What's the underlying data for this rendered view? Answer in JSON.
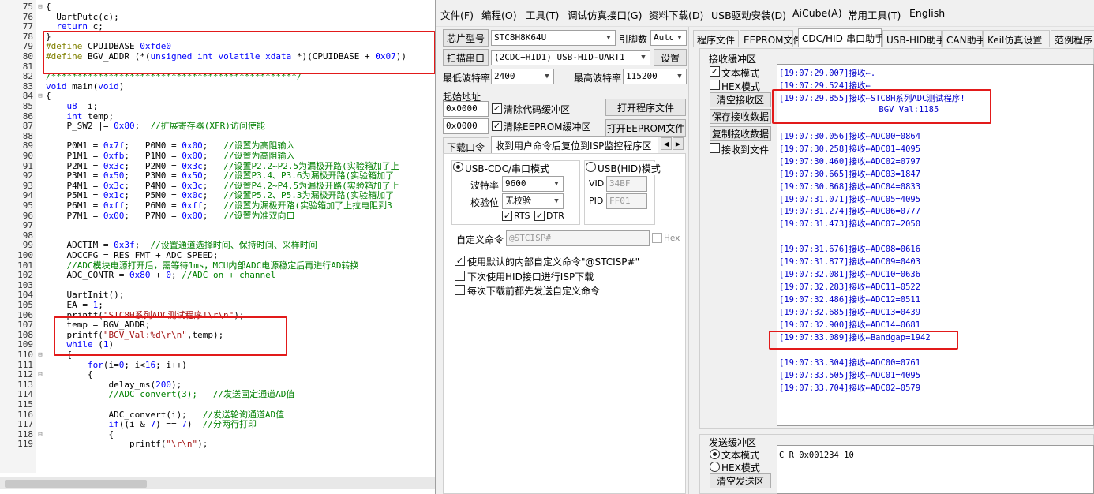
{
  "editor": {
    "lines": [
      {
        "n": "75",
        "f": "⊟",
        "t": [
          {
            "c": "pl",
            "v": "{"
          }
        ]
      },
      {
        "n": "76",
        "f": "",
        "t": [
          {
            "c": "pl",
            "v": "  UartPutc(c);"
          }
        ]
      },
      {
        "n": "77",
        "f": "",
        "t": [
          {
            "c": "kw",
            "v": "  return"
          },
          {
            "c": "pl",
            "v": " c;"
          }
        ]
      },
      {
        "n": "78",
        "f": "",
        "t": [
          {
            "c": "pl",
            "v": "}"
          }
        ]
      },
      {
        "n": "79",
        "f": "",
        "t": [
          {
            "c": "pp",
            "v": "#define"
          },
          {
            "c": "pl",
            "v": " CPUIDBASE "
          },
          {
            "c": "num",
            "v": "0xfde0"
          }
        ]
      },
      {
        "n": "80",
        "f": "",
        "t": [
          {
            "c": "pp",
            "v": "#define"
          },
          {
            "c": "pl",
            "v": " BGV_ADDR (*("
          },
          {
            "c": "kw",
            "v": "unsigned int volatile xdata"
          },
          {
            "c": "pl",
            "v": " *)(CPUIDBASE + "
          },
          {
            "c": "num",
            "v": "0x07"
          },
          {
            "c": "pl",
            "v": "))"
          }
        ]
      },
      {
        "n": "81",
        "f": "",
        "t": []
      },
      {
        "n": "82",
        "f": "",
        "t": [
          {
            "c": "cm",
            "v": "/***********************************************/"
          }
        ]
      },
      {
        "n": "83",
        "f": "",
        "t": [
          {
            "c": "kw",
            "v": "void"
          },
          {
            "c": "pl",
            "v": " main("
          },
          {
            "c": "kw",
            "v": "void"
          },
          {
            "c": "pl",
            "v": ")"
          }
        ]
      },
      {
        "n": "84",
        "f": "⊟",
        "t": [
          {
            "c": "pl",
            "v": "{"
          }
        ]
      },
      {
        "n": "85",
        "f": "",
        "t": [
          {
            "c": "kw",
            "v": "    u8"
          },
          {
            "c": "pl",
            "v": "  i;"
          }
        ]
      },
      {
        "n": "86",
        "f": "",
        "t": [
          {
            "c": "kw",
            "v": "    int"
          },
          {
            "c": "pl",
            "v": " temp;"
          }
        ]
      },
      {
        "n": "87",
        "f": "",
        "t": [
          {
            "c": "pl",
            "v": "    P_SW2 |= "
          },
          {
            "c": "num",
            "v": "0x80"
          },
          {
            "c": "pl",
            "v": ";  "
          },
          {
            "c": "cm",
            "v": "//扩展寄存器(XFR)访问使能"
          }
        ]
      },
      {
        "n": "88",
        "f": "",
        "t": []
      },
      {
        "n": "89",
        "f": "",
        "t": [
          {
            "c": "pl",
            "v": "    P0M1 = "
          },
          {
            "c": "num",
            "v": "0x7f"
          },
          {
            "c": "pl",
            "v": ";   P0M0 = "
          },
          {
            "c": "num",
            "v": "0x00"
          },
          {
            "c": "pl",
            "v": ";   "
          },
          {
            "c": "cm",
            "v": "//设置为高阻输入"
          }
        ]
      },
      {
        "n": "90",
        "f": "",
        "t": [
          {
            "c": "pl",
            "v": "    P1M1 = "
          },
          {
            "c": "num",
            "v": "0xfb"
          },
          {
            "c": "pl",
            "v": ";   P1M0 = "
          },
          {
            "c": "num",
            "v": "0x00"
          },
          {
            "c": "pl",
            "v": ";   "
          },
          {
            "c": "cm",
            "v": "//设置为高阻输入"
          }
        ]
      },
      {
        "n": "91",
        "f": "",
        "t": [
          {
            "c": "pl",
            "v": "    P2M1 = "
          },
          {
            "c": "num",
            "v": "0x3c"
          },
          {
            "c": "pl",
            "v": ";   P2M0 = "
          },
          {
            "c": "num",
            "v": "0x3c"
          },
          {
            "c": "pl",
            "v": ";   "
          },
          {
            "c": "cm",
            "v": "//设置P2.2~P2.5为漏极开路(实验箱加了上"
          }
        ]
      },
      {
        "n": "92",
        "f": "",
        "t": [
          {
            "c": "pl",
            "v": "    P3M1 = "
          },
          {
            "c": "num",
            "v": "0x50"
          },
          {
            "c": "pl",
            "v": ";   P3M0 = "
          },
          {
            "c": "num",
            "v": "0x50"
          },
          {
            "c": "pl",
            "v": ";   "
          },
          {
            "c": "cm",
            "v": "//设置P3.4、P3.6为漏极开路(实验箱加了"
          }
        ]
      },
      {
        "n": "93",
        "f": "",
        "t": [
          {
            "c": "pl",
            "v": "    P4M1 = "
          },
          {
            "c": "num",
            "v": "0x3c"
          },
          {
            "c": "pl",
            "v": ";   P4M0 = "
          },
          {
            "c": "num",
            "v": "0x3c"
          },
          {
            "c": "pl",
            "v": ";   "
          },
          {
            "c": "cm",
            "v": "//设置P4.2~P4.5为漏极开路(实验箱加了上"
          }
        ]
      },
      {
        "n": "94",
        "f": "",
        "t": [
          {
            "c": "pl",
            "v": "    P5M1 = "
          },
          {
            "c": "num",
            "v": "0x1c"
          },
          {
            "c": "pl",
            "v": ";   P5M0 = "
          },
          {
            "c": "num",
            "v": "0x0c"
          },
          {
            "c": "pl",
            "v": ";   "
          },
          {
            "c": "cm",
            "v": "//设置P5.2、P5.3为漏极开路(实验箱加了"
          }
        ]
      },
      {
        "n": "95",
        "f": "",
        "t": [
          {
            "c": "pl",
            "v": "    P6M1 = "
          },
          {
            "c": "num",
            "v": "0xff"
          },
          {
            "c": "pl",
            "v": ";   P6M0 = "
          },
          {
            "c": "num",
            "v": "0xff"
          },
          {
            "c": "pl",
            "v": ";   "
          },
          {
            "c": "cm",
            "v": "//设置为漏极开路(实验箱加了上拉电阻到3"
          }
        ]
      },
      {
        "n": "96",
        "f": "",
        "t": [
          {
            "c": "pl",
            "v": "    P7M1 = "
          },
          {
            "c": "num",
            "v": "0x00"
          },
          {
            "c": "pl",
            "v": ";   P7M0 = "
          },
          {
            "c": "num",
            "v": "0x00"
          },
          {
            "c": "pl",
            "v": ";   "
          },
          {
            "c": "cm",
            "v": "//设置为准双向口"
          }
        ]
      },
      {
        "n": "97",
        "f": "",
        "t": []
      },
      {
        "n": "98",
        "f": "",
        "t": []
      },
      {
        "n": "99",
        "f": "",
        "t": [
          {
            "c": "pl",
            "v": "    ADCTIM = "
          },
          {
            "c": "num",
            "v": "0x3f"
          },
          {
            "c": "pl",
            "v": ";  "
          },
          {
            "c": "cm",
            "v": "//设置通道选择时间、保持时间、采样时间"
          }
        ]
      },
      {
        "n": "100",
        "f": "",
        "t": [
          {
            "c": "pl",
            "v": "    ADCCFG = RES_FMT + ADC_SPEED;"
          }
        ]
      },
      {
        "n": "101",
        "f": "",
        "t": [
          {
            "c": "cm",
            "v": "    //ADC模块电源打开后，需等待1ms，MCU内部ADC电源稳定后再进行AD转换"
          }
        ]
      },
      {
        "n": "102",
        "f": "",
        "t": [
          {
            "c": "pl",
            "v": "    ADC_CONTR = "
          },
          {
            "c": "num",
            "v": "0x80"
          },
          {
            "c": "pl",
            "v": " + "
          },
          {
            "c": "num",
            "v": "0"
          },
          {
            "c": "pl",
            "v": "; "
          },
          {
            "c": "cm",
            "v": "//ADC on + channel"
          }
        ]
      },
      {
        "n": "103",
        "f": "",
        "t": []
      },
      {
        "n": "104",
        "f": "",
        "t": [
          {
            "c": "pl",
            "v": "    UartInit();"
          }
        ]
      },
      {
        "n": "105",
        "f": "",
        "t": [
          {
            "c": "pl",
            "v": "    EA = "
          },
          {
            "c": "num",
            "v": "1"
          },
          {
            "c": "pl",
            "v": ";"
          }
        ]
      },
      {
        "n": "106",
        "f": "",
        "t": [
          {
            "c": "pl",
            "v": "    printf("
          },
          {
            "c": "str",
            "v": "\"STC8H系列ADC测试程序!\\r\\n\""
          },
          {
            "c": "pl",
            "v": ");"
          }
        ]
      },
      {
        "n": "107",
        "f": "",
        "t": [
          {
            "c": "pl",
            "v": "    temp = BGV_ADDR;"
          }
        ]
      },
      {
        "n": "108",
        "f": "",
        "t": [
          {
            "c": "pl",
            "v": "    printf("
          },
          {
            "c": "str",
            "v": "\"BGV_Val:%d\\r\\n\""
          },
          {
            "c": "pl",
            "v": ",temp);"
          }
        ]
      },
      {
        "n": "109",
        "f": "",
        "t": [
          {
            "c": "kw",
            "v": "    while"
          },
          {
            "c": "pl",
            "v": " ("
          },
          {
            "c": "num",
            "v": "1"
          },
          {
            "c": "pl",
            "v": ")"
          }
        ]
      },
      {
        "n": "110",
        "f": "⊟",
        "t": [
          {
            "c": "pl",
            "v": "    {"
          }
        ]
      },
      {
        "n": "111",
        "f": "",
        "t": [
          {
            "c": "kw",
            "v": "        for"
          },
          {
            "c": "pl",
            "v": "(i="
          },
          {
            "c": "num",
            "v": "0"
          },
          {
            "c": "pl",
            "v": "; i<"
          },
          {
            "c": "num",
            "v": "16"
          },
          {
            "c": "pl",
            "v": "; i++)"
          }
        ]
      },
      {
        "n": "112",
        "f": "⊟",
        "t": [
          {
            "c": "pl",
            "v": "        {"
          }
        ]
      },
      {
        "n": "113",
        "f": "",
        "t": [
          {
            "c": "pl",
            "v": "            delay_ms("
          },
          {
            "c": "num",
            "v": "200"
          },
          {
            "c": "pl",
            "v": ");"
          }
        ]
      },
      {
        "n": "114",
        "f": "",
        "t": [
          {
            "c": "cm",
            "v": "            //ADC_convert(3);   //发送固定通道AD值"
          }
        ]
      },
      {
        "n": "115",
        "f": "",
        "t": []
      },
      {
        "n": "116",
        "f": "",
        "t": [
          {
            "c": "pl",
            "v": "            ADC_convert(i);   "
          },
          {
            "c": "cm",
            "v": "//发送轮询通道AD值"
          }
        ]
      },
      {
        "n": "117",
        "f": "",
        "t": [
          {
            "c": "kw",
            "v": "            if"
          },
          {
            "c": "pl",
            "v": "((i & "
          },
          {
            "c": "num",
            "v": "7"
          },
          {
            "c": "pl",
            "v": ") == "
          },
          {
            "c": "num",
            "v": "7"
          },
          {
            "c": "pl",
            "v": ")  "
          },
          {
            "c": "cm",
            "v": "//分两行打印"
          }
        ]
      },
      {
        "n": "118",
        "f": "⊟",
        "t": [
          {
            "c": "pl",
            "v": "            {"
          }
        ]
      },
      {
        "n": "119",
        "f": "",
        "t": [
          {
            "c": "pl",
            "v": "                printf("
          },
          {
            "c": "str",
            "v": "\"\\r\\n\""
          },
          {
            "c": "pl",
            "v": ");"
          }
        ]
      }
    ]
  },
  "menubar": [
    "文件(F)",
    "编程(O)",
    "工具(T)",
    "调试仿真接口(G)",
    "资料下载(D)",
    "USB驱动安装(D)",
    "AiCube(A)",
    "常用工具(T)",
    "English"
  ],
  "left": {
    "chip_btn": "芯片型号",
    "chip_val": "STC8H8K64U",
    "pin_label": "引脚数",
    "pin_val": "Auto",
    "scan_btn": "扫描串口",
    "port_val": "(2CDC+HID1) USB-HID-UART1",
    "settings_btn": "设置",
    "min_baud_label": "最低波特率",
    "min_baud": "2400",
    "max_baud_label": "最高波特率",
    "max_baud": "115200",
    "start_addr_label": "起始地址",
    "addr1": "0x0000",
    "clear_code_label": "清除代码缓冲区",
    "open_prog_btn": "打开程序文件",
    "addr2": "0x0000",
    "clear_eeprom_label": "清除EEPROM缓冲区",
    "open_eeprom_btn": "打开EEPROM文件",
    "tab_download": "下载口令",
    "tab_isp": "收到用户命令后复位到ISP监控程序区",
    "mode_cdc": "USB-CDC/串口模式",
    "mode_hid": "USB(HID)模式",
    "baud_label": "波特率",
    "baud_val": "9600",
    "parity_label": "校验位",
    "parity_val": "无校验",
    "vid_label": "VID",
    "vid_val": "34BF",
    "pid_label": "PID",
    "pid_val": "FF01",
    "rts_label": "RTS",
    "dtr_label": "DTR",
    "custom_cmd_label": "自定义命令",
    "custom_cmd_val": "@STCISP#",
    "hex_label": "Hex",
    "opt1": "使用默认的内部自定义命令\"@STCISP#\"",
    "opt2": "下次使用HID接口进行ISP下载",
    "opt3": "每次下载前都先发送自定义命令"
  },
  "right": {
    "tabs": [
      "程序文件",
      "EEPROM文件",
      "CDC/HID-串口助手",
      "USB-HID助手",
      "CAN助手",
      "Keil仿真设置",
      "范例程序"
    ],
    "rx_title": "接收缓冲区",
    "rx_text_mode": "文本模式",
    "rx_hex_mode": "HEX模式",
    "clear_rx_btn": "清空接收区",
    "save_rx_btn": "保存接收数据",
    "copy_rx_btn": "复制接收数据",
    "rx_to_file": "接收到文件",
    "rx_lines": [
      "[19:07:29.007]接收←.",
      "[19:07:29.524]接收←",
      "[19:07:29.855]接收←STC8H系列ADC测试程序!",
      "                    BGV_Val:1185",
      "",
      "[19:07:30.056]接收←ADC00=0864",
      "[19:07:30.258]接收←ADC01=4095",
      "[19:07:30.460]接收←ADC02=0797",
      "[19:07:30.665]接收←ADC03=1847",
      "[19:07:30.868]接收←ADC04=0833",
      "[19:07:31.071]接收←ADC05=4095",
      "[19:07:31.274]接收←ADC06=0777",
      "[19:07:31.473]接收←ADC07=2050",
      "",
      "[19:07:31.676]接收←ADC08=0616",
      "[19:07:31.877]接收←ADC09=0403",
      "[19:07:32.081]接收←ADC10=0636",
      "[19:07:32.283]接收←ADC11=0522",
      "[19:07:32.486]接收←ADC12=0511",
      "[19:07:32.685]接收←ADC13=0439",
      "[19:07:32.900]接收←ADC14=0681",
      "[19:07:33.089]接收←Bandgap=1942",
      "",
      "[19:07:33.304]接收←ADC00=0761",
      "[19:07:33.505]接收←ADC01=4095",
      "[19:07:33.704]接收←ADC02=0579"
    ],
    "tx_title": "发送缓冲区",
    "tx_text_mode": "文本模式",
    "tx_hex_mode": "HEX模式",
    "clear_tx_btn": "清空发送区",
    "tx_content": "C R 0x001234 10"
  }
}
